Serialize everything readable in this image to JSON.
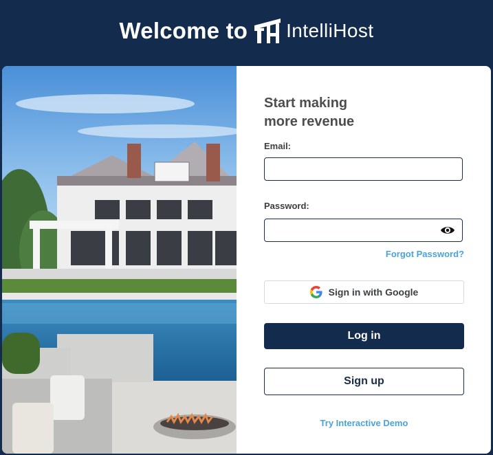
{
  "header": {
    "welcome": "Welcome to",
    "brand": "IntelliHost"
  },
  "form": {
    "headline_line1": "Start making",
    "headline_line2": "more revenue",
    "email_label": "Email:",
    "email_value": "",
    "password_label": "Password:",
    "password_value": "",
    "forgot_password": "Forgot Password?",
    "google_button": "Sign in with Google",
    "login_button": "Log in",
    "signup_button": "Sign up",
    "demo_link": "Try Interactive Demo"
  },
  "colors": {
    "navy": "#132c4d",
    "link_blue": "#4aa3d8"
  },
  "icons": [
    "logo-icon",
    "eye-icon",
    "google-icon"
  ]
}
